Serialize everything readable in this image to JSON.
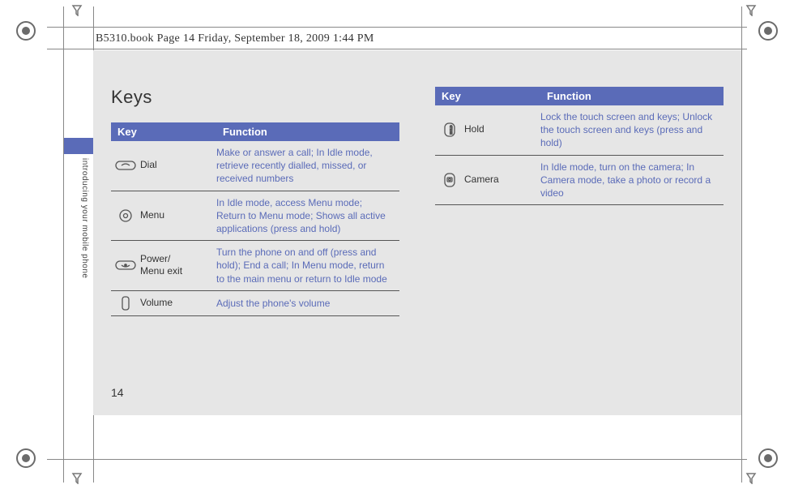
{
  "header_note": "B5310.book  Page 14  Friday, September 18, 2009  1:44 PM",
  "side_label": "introducing your mobile phone",
  "page_number": "14",
  "heading": "Keys",
  "table_headers": {
    "key": "Key",
    "function": "Function"
  },
  "left_keys": [
    {
      "name": "Dial",
      "function": "Make or answer a call; In Idle mode, retrieve recently dialled, missed, or received numbers"
    },
    {
      "name": "Menu",
      "function": "In Idle mode, access Menu mode; Return to Menu mode; Shows all active applications (press and hold)"
    },
    {
      "name": "Power/\nMenu exit",
      "function": "Turn the phone on and off (press and hold); End a call; In Menu mode, return to the main menu or return to Idle mode"
    },
    {
      "name": "Volume",
      "function": "Adjust the phone's volume"
    }
  ],
  "right_keys": [
    {
      "name": "Hold",
      "function": "Lock the touch screen and keys; Unlock the touch screen and keys (press and hold)"
    },
    {
      "name": "Camera",
      "function": "In Idle mode, turn on the camera; In Camera mode, take a photo or record a video"
    }
  ]
}
